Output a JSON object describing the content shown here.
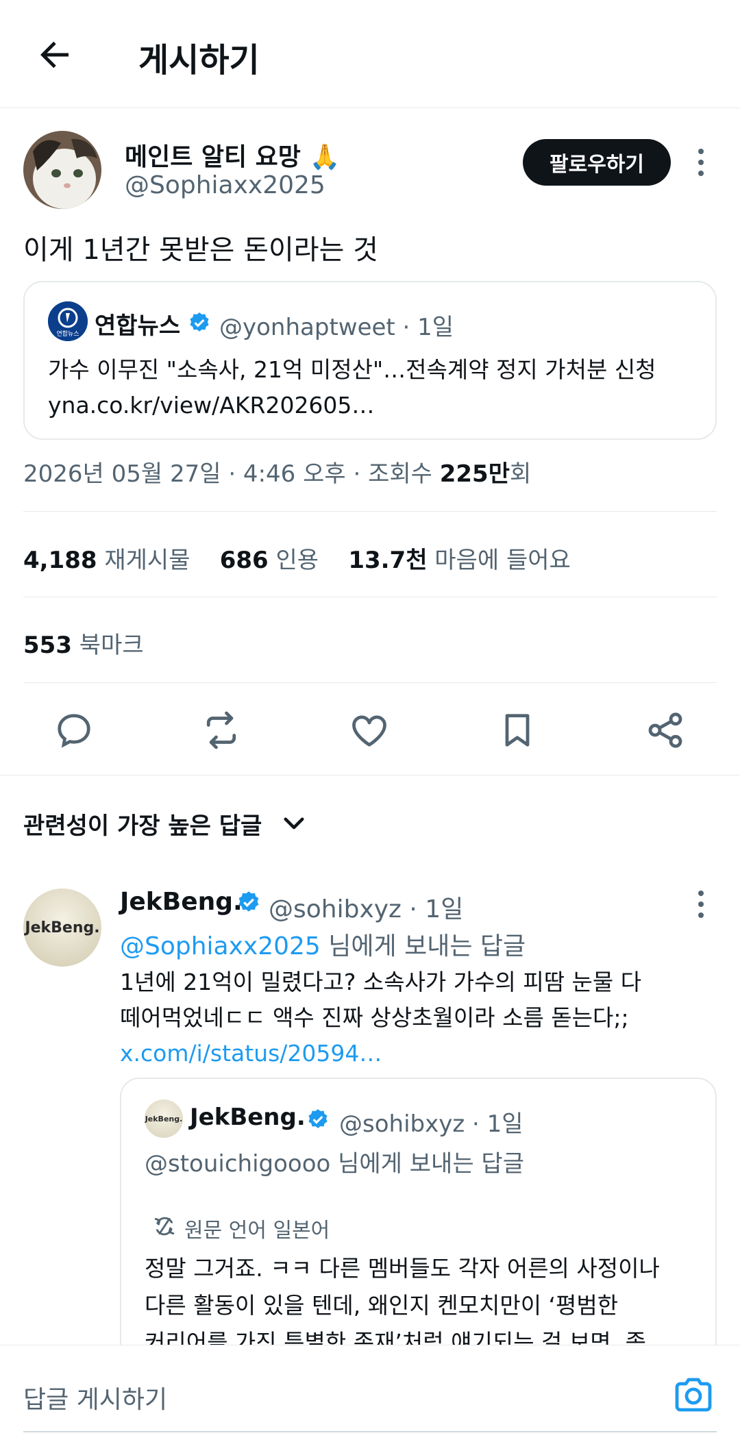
{
  "header": {
    "title": "게시하기"
  },
  "post": {
    "display_name": "메인트 알티 요망 🙏",
    "handle": "@Sophiaxx2025",
    "follow_label": "팔로우하기",
    "text": "이게 1년간 못받은 돈이라는 것",
    "quote": {
      "name": "연합뉴스",
      "meta": "@yonhaptweet · 1일",
      "avatar_label": "연합뉴스",
      "text_line1": "가수 이무진 \"소속사, 21억 미정산\"…전속계약 정지 가처분 신청",
      "text_line2": "yna.co.kr/view/AKR202605…"
    },
    "timestamp": "2026년 05월 27일 · 4:46 오후 · 조회수 ",
    "views_value": "225만",
    "views_unit": "회",
    "stats": {
      "reposts_value": "4,188",
      "reposts_label": "재게시물",
      "quotes_value": "686",
      "quotes_label": "인용",
      "likes_value": "13.7천",
      "likes_label": "마음에 들어요",
      "bookmarks_value": "553",
      "bookmarks_label": "북마크"
    }
  },
  "replies_section": {
    "sort_label": "관련성이 가장 높은 답글"
  },
  "reply": {
    "name": "JekBeng.",
    "avatar_label": "JekBeng.",
    "meta": "@sohibxyz · 1일",
    "replying_to_handle": "@Sophiaxx2025",
    "replying_to_suffix": " 님에게 보내는 답글",
    "text_line1": "1년에 21억이 밀렸다고? 소속사가 가수의 피땀 눈물 다",
    "text_line2": "떼어먹었네ㄷㄷ 액수 진짜 상상초월이라 소름 돋는다;;",
    "link": "x.com/i/status/20594…",
    "quote": {
      "name": "JekBeng.",
      "avatar_label": "JekBeng.",
      "meta": "@sohibxyz · 1일",
      "replying_to": "@stouichigoooo 님에게 보내는 답글",
      "translate_label": "원문 언어 일본어",
      "text_line1": "정말 그거죠. ㅋㅋ 다른 멤버들도 각자 어른의 사정이나",
      "text_line2": "다른 활동이 있을 텐데, 왜인지 켄모치만이 ‘평범한",
      "text_line3": "커리어를 가진 특별한 존재’처럼 얘기되는 걸 보면, 좀"
    }
  },
  "composer": {
    "placeholder": "답글 게시하기"
  },
  "colors": {
    "accent": "#1d9bf0",
    "text": "#0f1419",
    "secondary": "#536471",
    "border": "#e6e9eb"
  }
}
